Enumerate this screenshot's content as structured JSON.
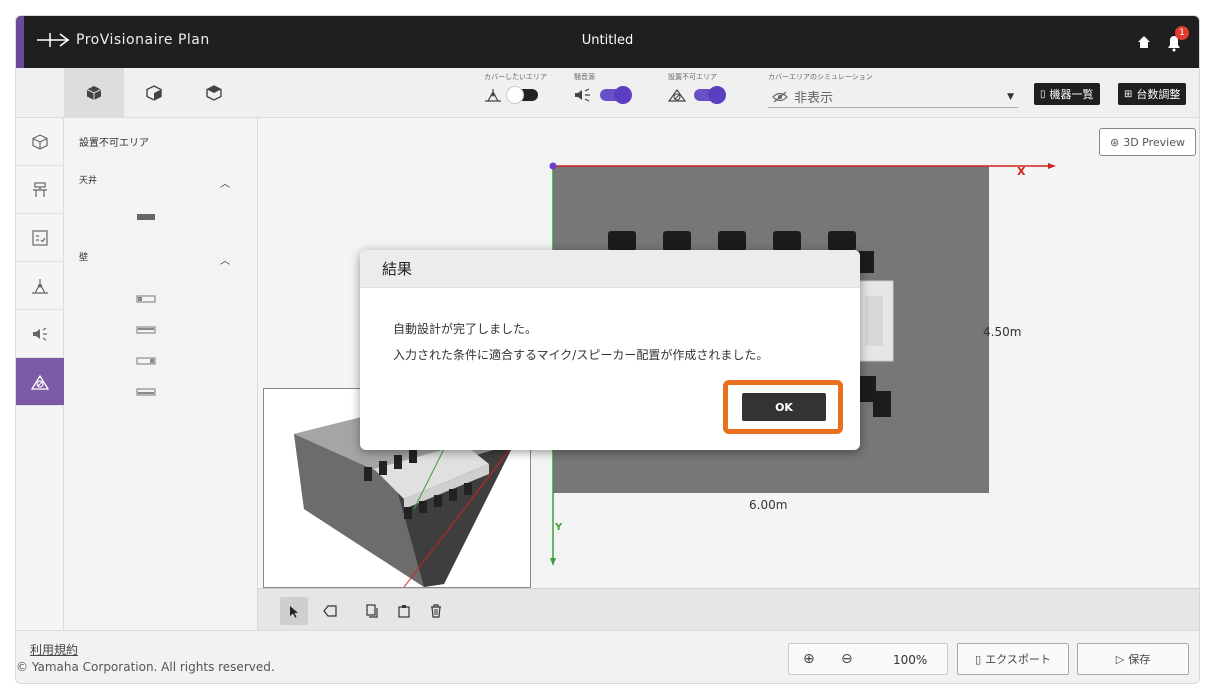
{
  "header": {
    "logo_text": "ProVisionaire Plan",
    "title": "Untitled",
    "notification_count": "1"
  },
  "toolbar": {
    "cover_area_label": "カバーしたいエリア",
    "noise_label": "騒音源",
    "no_install_label": "設置不可エリア",
    "sim_label": "カバーエリアのシミュレーション",
    "sim_value": "非表示",
    "device_list_label": "機器一覧",
    "device_count_label": "台数調整",
    "cover_area_on": false,
    "noise_on": true,
    "no_install_on": true
  },
  "side_panel": {
    "title": "設置不可エリア",
    "ceiling_label": "天井",
    "wall_label": "壁"
  },
  "canvas": {
    "preview_label": "3D Preview",
    "width_label": "6.00m",
    "height_label": "4.50m",
    "x_axis_label": "X",
    "y_axis_label": "Y"
  },
  "footer": {
    "terms_label": "利用規約",
    "copyright": "© Yamaha Corporation. All rights reserved.",
    "zoom_level": "100%",
    "export_label": "エクスポート",
    "save_label": "保存"
  },
  "dialog": {
    "title": "結果",
    "message_line1": "自動設計が完了しました。",
    "message_line2": "入力された条件に適合するマイク/スピーカー配置が作成されました。",
    "ok_label": "OK"
  },
  "colors": {
    "header_bg": "#1f1f1f",
    "accent_purple": "#7b5ba6",
    "toggle_on": "#6a50c8",
    "highlight_orange": "#e8701e"
  }
}
